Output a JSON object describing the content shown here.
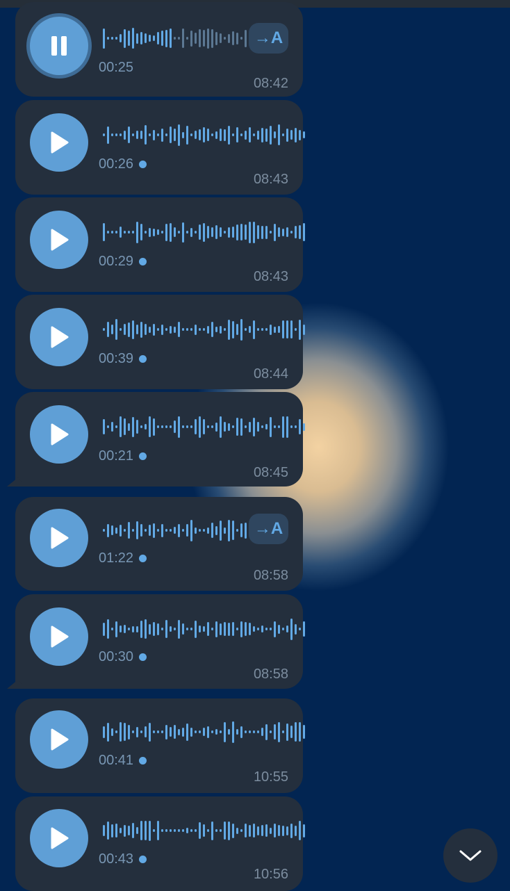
{
  "messages": [
    {
      "duration": "00:25",
      "time": "08:42",
      "state": "playing",
      "unread": false,
      "transcribe_label": "→A"
    },
    {
      "duration": "00:26",
      "time": "08:43",
      "state": "paused",
      "unread": true
    },
    {
      "duration": "00:29",
      "time": "08:43",
      "state": "paused",
      "unread": true
    },
    {
      "duration": "00:39",
      "time": "08:44",
      "state": "paused",
      "unread": true
    },
    {
      "duration": "00:21",
      "time": "08:45",
      "state": "paused",
      "unread": true
    },
    {
      "duration": "01:22",
      "time": "08:58",
      "state": "paused",
      "unread": true,
      "transcribe_label": "→A"
    },
    {
      "duration": "00:30",
      "time": "08:58",
      "state": "paused",
      "unread": true
    },
    {
      "duration": "00:41",
      "time": "10:55",
      "state": "paused",
      "unread": true
    },
    {
      "duration": "00:43",
      "time": "10:56",
      "state": "paused",
      "unread": true
    }
  ],
  "icons": {
    "play": "play-icon",
    "pause": "pause-icon",
    "scroll_down": "chevron-down-icon",
    "transcribe": "transcribe-icon"
  },
  "colors": {
    "background": "#022552",
    "bubble": "#242f3d",
    "accent": "#62a9e5",
    "play_button": "#5f9fd6",
    "timestamp": "#7c8d9f"
  }
}
